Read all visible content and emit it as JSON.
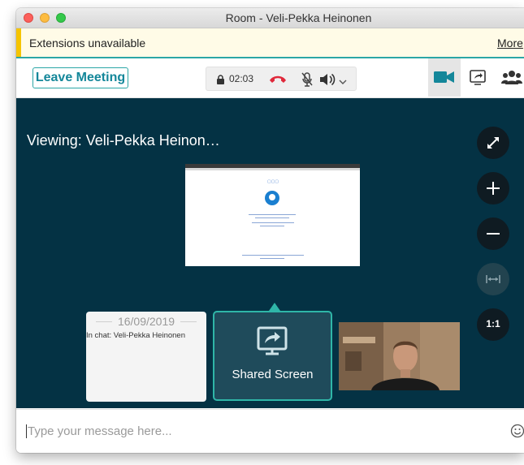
{
  "window": {
    "title": "Room - Veli-Pekka Heinonen"
  },
  "notice": {
    "text": "Extensions unavailable",
    "more_label": "More"
  },
  "toolbar": {
    "leave_label": "Leave Meeting",
    "timer": "02:03",
    "icons": [
      "lock-icon",
      "hangup-icon",
      "mic-muted-icon",
      "volume-icon",
      "chevron-down-icon",
      "camera-icon",
      "share-screen-icon",
      "people-icon"
    ]
  },
  "stage": {
    "viewing_label": "Viewing: Veli-Pekka Heinon…",
    "controls": {
      "one_to_one_label": "1:1"
    },
    "chat_card": {
      "date": "16/09/2019",
      "text": "In chat: Veli-Pekka Heinonen"
    },
    "share_card": {
      "label": "Shared Screen"
    }
  },
  "composer": {
    "placeholder": "Type your message here..."
  },
  "colors": {
    "accent": "#2ba6a6",
    "stage_bg": "#043244",
    "hangup": "#e0283a",
    "camera": "#14879a"
  }
}
